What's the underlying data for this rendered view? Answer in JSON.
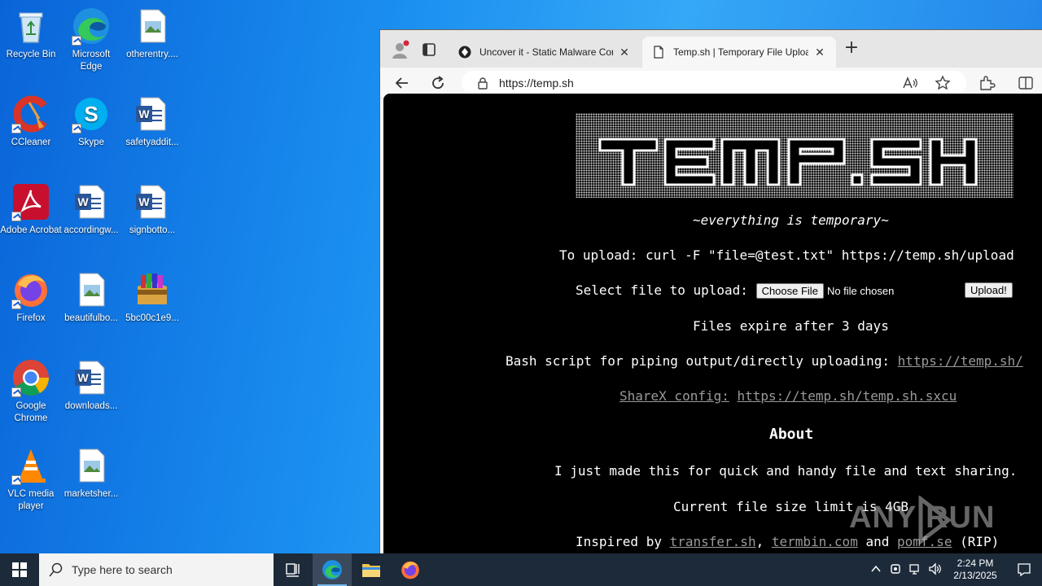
{
  "desktop": {
    "icons": [
      {
        "label": "Recycle Bin",
        "icon": "recycle-bin-icon"
      },
      {
        "label": "Microsoft Edge",
        "icon": "edge-icon"
      },
      {
        "label": "otherentry....",
        "icon": "image-file-icon"
      },
      {
        "label": "CCleaner",
        "icon": "ccleaner-icon"
      },
      {
        "label": "Skype",
        "icon": "skype-icon"
      },
      {
        "label": "safetyaddit...",
        "icon": "word-doc-icon"
      },
      {
        "label": "Adobe Acrobat",
        "icon": "acrobat-icon"
      },
      {
        "label": "accordingw...",
        "icon": "word-doc-icon"
      },
      {
        "label": "signbotto...",
        "icon": "word-doc-icon"
      },
      {
        "label": "Firefox",
        "icon": "firefox-icon"
      },
      {
        "label": "beautifulbo...",
        "icon": "image-file-icon"
      },
      {
        "label": "5bc00c1e9...",
        "icon": "archive-icon"
      },
      {
        "label": "Google Chrome",
        "icon": "chrome-icon"
      },
      {
        "label": "downloads...",
        "icon": "word-doc-icon"
      },
      {
        "label": "VLC media player",
        "icon": "vlc-icon"
      },
      {
        "label": "marketsher...",
        "icon": "image-file-icon"
      }
    ]
  },
  "browser": {
    "tabs": [
      {
        "title": "Uncover it - Static Malware Confi",
        "close": "✕"
      },
      {
        "title": "Temp.sh | Temporary File Upload",
        "close": "✕"
      }
    ],
    "new_tab": "+",
    "address": "https://temp.sh"
  },
  "page": {
    "tagline": "~everything is temporary~",
    "upload_cmd": "To upload: curl -F \"file=@test.txt\" https://temp.sh/upload",
    "select_label": "Select file to upload:",
    "choose_file": "Choose File",
    "no_file": "No file chosen",
    "upload_btn": "Upload!",
    "expire": "Files expire after 3 days",
    "bash_label": "Bash script for piping output/directly uploading:",
    "bash_link": "https://temp.sh/",
    "sharex_label": "ShareX config:",
    "sharex_link": "https://temp.sh/temp.sh.sxcu",
    "about_heading": "About",
    "about_text": "I just made this for quick and handy file and text sharing.",
    "size_limit": "Current file size limit is 4GB",
    "inspired_prefix": "Inspired by",
    "inspired_link1": "transfer.sh",
    "inspired_comma": ",",
    "inspired_link2": "termbin.com",
    "inspired_and": "and",
    "inspired_link3": "pomf.se",
    "inspired_suffix": "(RIP)",
    "watermark": "ANY RUN"
  },
  "taskbar": {
    "search_placeholder": "Type here to search",
    "time": "2:24 PM",
    "date": "2/13/2025"
  },
  "colors": {
    "accent": "#0078d4",
    "page_bg": "#000000",
    "link": "#9a9a9a",
    "taskbar": "#1c2a3a"
  }
}
